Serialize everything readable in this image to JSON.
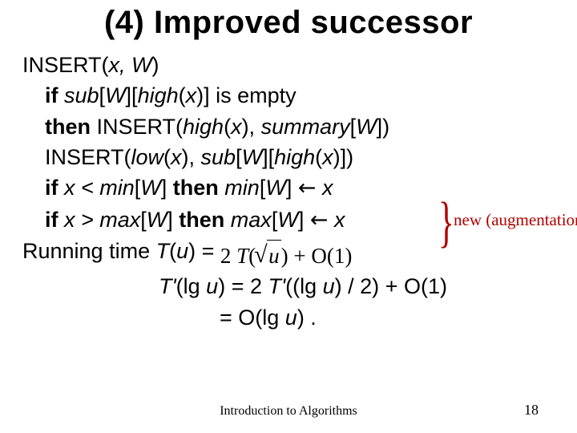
{
  "title": "(4) Improved successor",
  "lines": {
    "l0a": "INSERT(",
    "l0b": "x, W",
    "l0c": ")",
    "l1a": "if",
    "l1b": " sub",
    "l1c": "[",
    "l1d": "W",
    "l1e": "][",
    "l1f": "high",
    "l1g": "(",
    "l1h": "x",
    "l1i": ")] is empty",
    "l2a": "then",
    "l2b": " INSERT(",
    "l2c": "high",
    "l2d": "(",
    "l2e": "x",
    "l2f": "), ",
    "l2g": "summary",
    "l2h": "[",
    "l2i": "W",
    "l2j": "])",
    "l3a": "INSERT(",
    "l3b": "low",
    "l3c": "(",
    "l3d": "x",
    "l3e": "), ",
    "l3f": "sub",
    "l3g": "[",
    "l3h": "W",
    "l3i": "][",
    "l3j": "high",
    "l3k": "(",
    "l3l": "x",
    "l3m": ")])",
    "l4a": "if",
    "l4b": " x < min",
    "l4c": "[",
    "l4d": "W",
    "l4e": "] ",
    "l4f": "then",
    "l4g": " min",
    "l4h": "[",
    "l4i": "W",
    "l4j": "] ",
    "l4arrow": "←",
    "l4k": " x",
    "l5a": "if",
    "l5b": " x > max",
    "l5c": "[",
    "l5d": "W",
    "l5e": "] ",
    "l5f": "then",
    "l5g": " max",
    "l5h": "[",
    "l5i": "W",
    "l5j": "] ",
    "l5arrow": "←",
    "l5k": "  x",
    "l6a": "Running time ",
    "l6b": "T",
    "l6c": "(",
    "l6d": "u",
    "l6e": ") = ",
    "rec_pre": "2 ",
    "rec_T": "T",
    "rec_lp": "(",
    "rec_u": "u",
    "rec_rp": ")",
    "rec_plus": " + O(1)",
    "l7a": "T'",
    "l7b": "(lg ",
    "l7c": "u",
    "l7d": ") = 2 ",
    "l7e": " T'",
    "l7f": "((lg ",
    "l7g": "u",
    "l7h": ") / 2) + O(1)",
    "l8a": "= O(lg ",
    "l8b": "u",
    "l8c": ") ."
  },
  "annotation": "new (augmentation)",
  "footer_center": "Introduction to Algorithms",
  "footer_right": "18"
}
